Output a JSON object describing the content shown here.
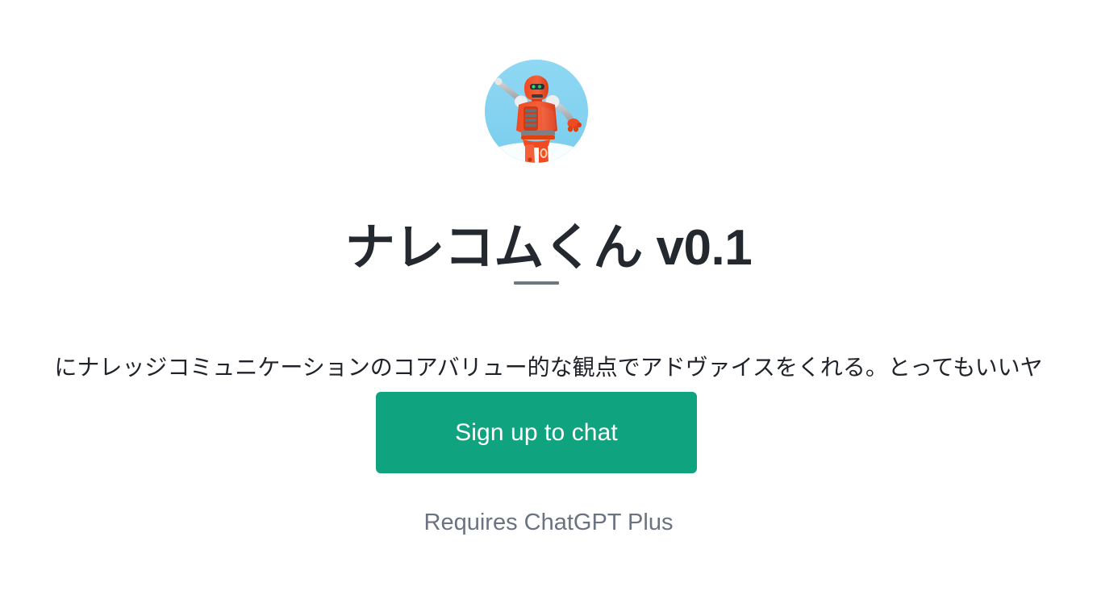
{
  "colors": {
    "background": "#ffffff",
    "accent_green": "#10a37f",
    "title_text": "#24292f",
    "body_text": "#20242a",
    "muted_text": "#6b7280",
    "divider": "#6e7781",
    "avatar_sky": "#86d3f0",
    "robot_orange": "#f4532a",
    "robot_gray": "#b6b9bd"
  },
  "avatar": {
    "icon_name": "robot-avatar",
    "alt": "orange robot on light blue circular background"
  },
  "header": {
    "title": "ナレコムくん v0.1"
  },
  "divider": {
    "name": "title-divider"
  },
  "main": {
    "description": "にナレッジコミュニケーションのコアバリュー的な観点でアドヴァイスをくれる。とってもいいヤ",
    "cta_label": "Sign up to chat",
    "requires_note": "Requires ChatGPT Plus"
  }
}
